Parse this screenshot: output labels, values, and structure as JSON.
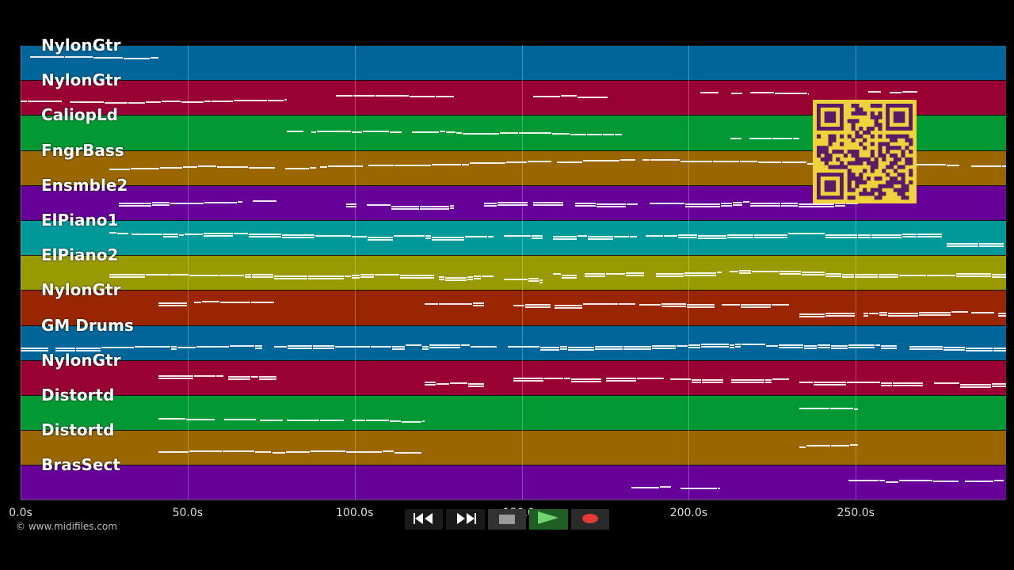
{
  "tracks": [
    {
      "name": "NylonGtr",
      "color": "#00669a"
    },
    {
      "name": "NylonGtr",
      "color": "#990033"
    },
    {
      "name": "CaliopLd",
      "color": "#009933"
    },
    {
      "name": "FngrBass",
      "color": "#996600"
    },
    {
      "name": "Ensmble2",
      "color": "#660099"
    },
    {
      "name": "ElPiano1",
      "color": "#009999"
    },
    {
      "name": "ElPiano2",
      "color": "#999900"
    },
    {
      "name": "NylonGtr",
      "color": "#992600"
    },
    {
      "name": "GM Drums",
      "color": "#00669a"
    },
    {
      "name": "NylonGtr",
      "color": "#990033"
    },
    {
      "name": "Distortd",
      "color": "#009933"
    },
    {
      "name": "Distortd",
      "color": "#996600"
    },
    {
      "name": "BrasSect",
      "color": "#660099"
    }
  ],
  "time_axis": {
    "ticks": [
      "0.0s",
      "50.0s",
      "100.0s",
      "150.0s",
      "200.0s",
      "250.0s"
    ],
    "tick_seconds": [
      0,
      50,
      100,
      150,
      200,
      250
    ],
    "duration_seconds": 295
  },
  "credit": "© www.midifiles.com",
  "transport": {
    "rewind_icon": "rewind-icon",
    "forward_icon": "fast-forward-icon",
    "stop_icon": "stop-icon",
    "play_icon": "play-icon",
    "record_icon": "record-icon"
  },
  "colors": {
    "background": "#000000",
    "play_active": "#2e7d32",
    "record": "#e53935",
    "qr_yellow": "#f2d23a",
    "qr_dark": "#5a1a6a"
  }
}
